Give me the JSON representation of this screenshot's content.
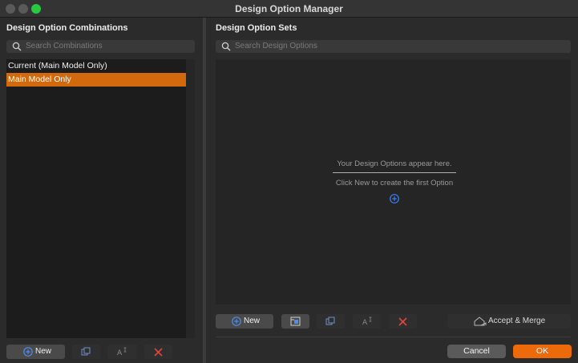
{
  "window": {
    "title": "Design Option Manager"
  },
  "left_panel": {
    "heading": "Design Option Combinations",
    "search": {
      "placeholder": "Search Combinations",
      "icon": "search-icon"
    },
    "items": [
      {
        "label": "Current (Main Model Only)",
        "selected": false
      },
      {
        "label": "Main Model Only",
        "selected": true
      }
    ],
    "toolbar": {
      "new_label": "New",
      "buttons": [
        "new-combination",
        "duplicate-icon",
        "rename-icon",
        "delete-icon"
      ]
    }
  },
  "right_panel": {
    "heading": "Design Option Sets",
    "search": {
      "placeholder": "Search Design Options",
      "icon": "search-icon"
    },
    "empty_state": {
      "title": "Your Design Options appear here.",
      "hint": "Click New to create the first Option"
    },
    "toolbar": {
      "new_label": "New",
      "accept_merge_label": "Accept & Merge"
    }
  },
  "footer": {
    "cancel_label": "Cancel",
    "ok_label": "OK"
  },
  "colors": {
    "accent": "#ec6a0a",
    "selection": "#d26a0d",
    "zoom_light": "#28c840",
    "add_icon": "#3b82f6",
    "delete_icon": "#e0463c"
  }
}
